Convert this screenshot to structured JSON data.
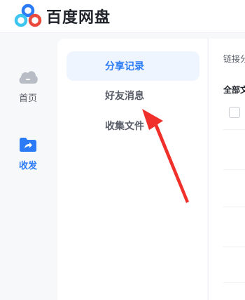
{
  "brand": {
    "name": "百度网盘",
    "logo_icon": "baidu-netdisk-logo-icon"
  },
  "leftnav": {
    "items": [
      {
        "label": "首页",
        "icon": "cloud-icon",
        "active": false
      },
      {
        "label": "收发",
        "icon": "share-folder-icon",
        "active": true
      }
    ]
  },
  "share_menu": {
    "tabs": [
      {
        "label": "分享记录",
        "active": true
      },
      {
        "label": "好友消息",
        "active": false
      },
      {
        "label": "收集文件",
        "active": false
      }
    ]
  },
  "content": {
    "link_label": "链接分",
    "all_label": "全部文"
  },
  "colors": {
    "accent": "#2a7bf5",
    "active_tab_bg": "#eef5fe",
    "annotation_arrow": "#f0302a"
  }
}
